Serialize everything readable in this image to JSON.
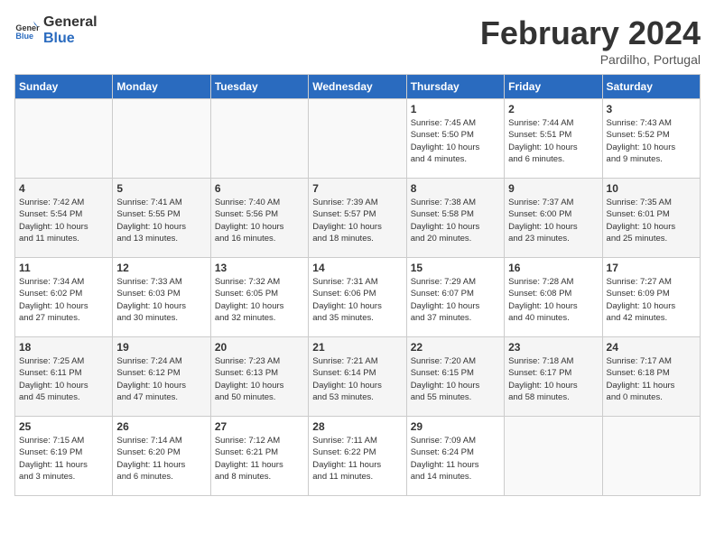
{
  "header": {
    "logo_general": "General",
    "logo_blue": "Blue",
    "month_year": "February 2024",
    "location": "Pardilho, Portugal"
  },
  "days_of_week": [
    "Sunday",
    "Monday",
    "Tuesday",
    "Wednesday",
    "Thursday",
    "Friday",
    "Saturday"
  ],
  "weeks": [
    [
      {
        "day": "",
        "info": ""
      },
      {
        "day": "",
        "info": ""
      },
      {
        "day": "",
        "info": ""
      },
      {
        "day": "",
        "info": ""
      },
      {
        "day": "1",
        "info": "Sunrise: 7:45 AM\nSunset: 5:50 PM\nDaylight: 10 hours\nand 4 minutes."
      },
      {
        "day": "2",
        "info": "Sunrise: 7:44 AM\nSunset: 5:51 PM\nDaylight: 10 hours\nand 6 minutes."
      },
      {
        "day": "3",
        "info": "Sunrise: 7:43 AM\nSunset: 5:52 PM\nDaylight: 10 hours\nand 9 minutes."
      }
    ],
    [
      {
        "day": "4",
        "info": "Sunrise: 7:42 AM\nSunset: 5:54 PM\nDaylight: 10 hours\nand 11 minutes."
      },
      {
        "day": "5",
        "info": "Sunrise: 7:41 AM\nSunset: 5:55 PM\nDaylight: 10 hours\nand 13 minutes."
      },
      {
        "day": "6",
        "info": "Sunrise: 7:40 AM\nSunset: 5:56 PM\nDaylight: 10 hours\nand 16 minutes."
      },
      {
        "day": "7",
        "info": "Sunrise: 7:39 AM\nSunset: 5:57 PM\nDaylight: 10 hours\nand 18 minutes."
      },
      {
        "day": "8",
        "info": "Sunrise: 7:38 AM\nSunset: 5:58 PM\nDaylight: 10 hours\nand 20 minutes."
      },
      {
        "day": "9",
        "info": "Sunrise: 7:37 AM\nSunset: 6:00 PM\nDaylight: 10 hours\nand 23 minutes."
      },
      {
        "day": "10",
        "info": "Sunrise: 7:35 AM\nSunset: 6:01 PM\nDaylight: 10 hours\nand 25 minutes."
      }
    ],
    [
      {
        "day": "11",
        "info": "Sunrise: 7:34 AM\nSunset: 6:02 PM\nDaylight: 10 hours\nand 27 minutes."
      },
      {
        "day": "12",
        "info": "Sunrise: 7:33 AM\nSunset: 6:03 PM\nDaylight: 10 hours\nand 30 minutes."
      },
      {
        "day": "13",
        "info": "Sunrise: 7:32 AM\nSunset: 6:05 PM\nDaylight: 10 hours\nand 32 minutes."
      },
      {
        "day": "14",
        "info": "Sunrise: 7:31 AM\nSunset: 6:06 PM\nDaylight: 10 hours\nand 35 minutes."
      },
      {
        "day": "15",
        "info": "Sunrise: 7:29 AM\nSunset: 6:07 PM\nDaylight: 10 hours\nand 37 minutes."
      },
      {
        "day": "16",
        "info": "Sunrise: 7:28 AM\nSunset: 6:08 PM\nDaylight: 10 hours\nand 40 minutes."
      },
      {
        "day": "17",
        "info": "Sunrise: 7:27 AM\nSunset: 6:09 PM\nDaylight: 10 hours\nand 42 minutes."
      }
    ],
    [
      {
        "day": "18",
        "info": "Sunrise: 7:25 AM\nSunset: 6:11 PM\nDaylight: 10 hours\nand 45 minutes."
      },
      {
        "day": "19",
        "info": "Sunrise: 7:24 AM\nSunset: 6:12 PM\nDaylight: 10 hours\nand 47 minutes."
      },
      {
        "day": "20",
        "info": "Sunrise: 7:23 AM\nSunset: 6:13 PM\nDaylight: 10 hours\nand 50 minutes."
      },
      {
        "day": "21",
        "info": "Sunrise: 7:21 AM\nSunset: 6:14 PM\nDaylight: 10 hours\nand 53 minutes."
      },
      {
        "day": "22",
        "info": "Sunrise: 7:20 AM\nSunset: 6:15 PM\nDaylight: 10 hours\nand 55 minutes."
      },
      {
        "day": "23",
        "info": "Sunrise: 7:18 AM\nSunset: 6:17 PM\nDaylight: 10 hours\nand 58 minutes."
      },
      {
        "day": "24",
        "info": "Sunrise: 7:17 AM\nSunset: 6:18 PM\nDaylight: 11 hours\nand 0 minutes."
      }
    ],
    [
      {
        "day": "25",
        "info": "Sunrise: 7:15 AM\nSunset: 6:19 PM\nDaylight: 11 hours\nand 3 minutes."
      },
      {
        "day": "26",
        "info": "Sunrise: 7:14 AM\nSunset: 6:20 PM\nDaylight: 11 hours\nand 6 minutes."
      },
      {
        "day": "27",
        "info": "Sunrise: 7:12 AM\nSunset: 6:21 PM\nDaylight: 11 hours\nand 8 minutes."
      },
      {
        "day": "28",
        "info": "Sunrise: 7:11 AM\nSunset: 6:22 PM\nDaylight: 11 hours\nand 11 minutes."
      },
      {
        "day": "29",
        "info": "Sunrise: 7:09 AM\nSunset: 6:24 PM\nDaylight: 11 hours\nand 14 minutes."
      },
      {
        "day": "",
        "info": ""
      },
      {
        "day": "",
        "info": ""
      }
    ]
  ]
}
